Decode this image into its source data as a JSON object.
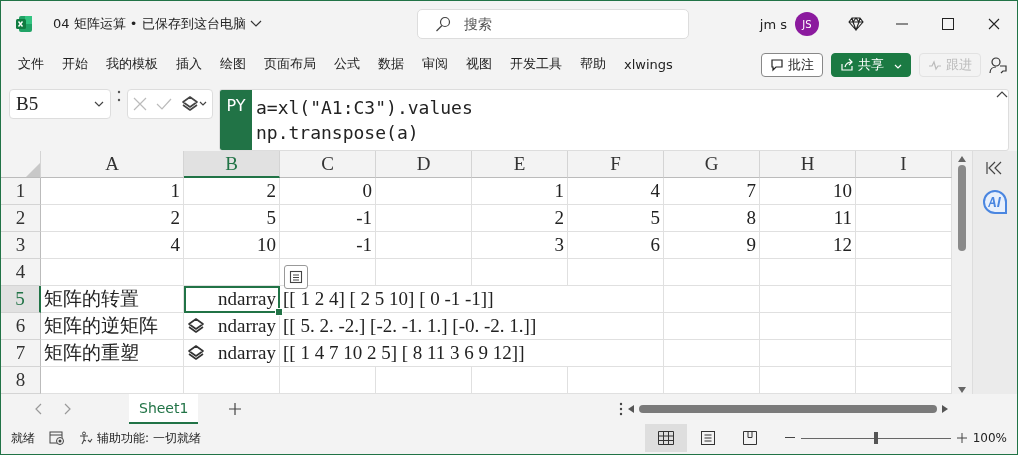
{
  "window": {
    "title": "04 矩阵运算 • 已保存到这台电脑",
    "search": {
      "placeholder": "搜索"
    },
    "user": {
      "name": "jm s",
      "initials": "JS"
    }
  },
  "ribbon_tabs": [
    {
      "label": "文件",
      "selected": false
    },
    {
      "label": "开始",
      "selected": false
    },
    {
      "label": "我的模板",
      "selected": false
    },
    {
      "label": "插入",
      "selected": false
    },
    {
      "label": "绘图",
      "selected": false
    },
    {
      "label": "页面布局",
      "selected": false
    },
    {
      "label": "公式",
      "selected": false
    },
    {
      "label": "数据",
      "selected": false
    },
    {
      "label": "审阅",
      "selected": false
    },
    {
      "label": "视图",
      "selected": false
    },
    {
      "label": "开发工具",
      "selected": false
    },
    {
      "label": "帮助",
      "selected": false
    },
    {
      "label": "xlwings",
      "selected": false
    }
  ],
  "ribbon_buttons": [
    {
      "kind": "comment",
      "label": "批注",
      "disabled": false
    },
    {
      "kind": "share",
      "label": "共享",
      "disabled": false
    },
    {
      "kind": "follow",
      "label": "跟进",
      "disabled": true
    }
  ],
  "formula_bar": {
    "name_box": "B5",
    "badge": "PY",
    "lines": [
      "a=xl(\"A1:C3\").values",
      "np.transpose(a)"
    ]
  },
  "columns": [
    {
      "label": "A",
      "selected": false
    },
    {
      "label": "B",
      "selected": true
    },
    {
      "label": "C",
      "selected": false
    },
    {
      "label": "D",
      "selected": false
    },
    {
      "label": "E",
      "selected": false
    },
    {
      "label": "F",
      "selected": false
    },
    {
      "label": "G",
      "selected": false
    },
    {
      "label": "H",
      "selected": false
    },
    {
      "label": "I",
      "selected": false
    }
  ],
  "rows": [
    {
      "label": "1",
      "selected": false,
      "cells": [
        {
          "kind": "number",
          "text": "1"
        },
        {
          "kind": "number",
          "text": "2"
        },
        {
          "kind": "number",
          "text": "0"
        },
        null,
        {
          "kind": "number",
          "text": "1"
        },
        {
          "kind": "number",
          "text": "4"
        },
        {
          "kind": "number",
          "text": "7"
        },
        {
          "kind": "number",
          "text": "10"
        },
        null
      ]
    },
    {
      "label": "2",
      "selected": false,
      "cells": [
        {
          "kind": "number",
          "text": "2"
        },
        {
          "kind": "number",
          "text": "5"
        },
        {
          "kind": "number",
          "text": "-1"
        },
        null,
        {
          "kind": "number",
          "text": "2"
        },
        {
          "kind": "number",
          "text": "5"
        },
        {
          "kind": "number",
          "text": "8"
        },
        {
          "kind": "number",
          "text": "11"
        },
        null
      ]
    },
    {
      "label": "3",
      "selected": false,
      "cells": [
        {
          "kind": "number",
          "text": "4"
        },
        {
          "kind": "number",
          "text": "10"
        },
        {
          "kind": "number",
          "text": "-1"
        },
        null,
        {
          "kind": "number",
          "text": "3"
        },
        {
          "kind": "number",
          "text": "6"
        },
        {
          "kind": "number",
          "text": "9"
        },
        {
          "kind": "number",
          "text": "12"
        },
        null
      ]
    },
    {
      "label": "4",
      "selected": false,
      "cells": [
        null,
        null,
        null,
        null,
        null,
        null,
        null,
        null,
        null
      ]
    },
    {
      "label": "5",
      "selected": true,
      "cells": [
        {
          "kind": "text",
          "text": "矩阵的转置"
        },
        {
          "kind": "python",
          "text": "ndarray",
          "icon": false
        },
        {
          "kind": "text",
          "text": "[[ 1  2  4] [ 2  5 10] [ 0 -1 -1]]"
        },
        null,
        null,
        null,
        null,
        null,
        null
      ]
    },
    {
      "label": "6",
      "selected": false,
      "cells": [
        {
          "kind": "text",
          "text": "矩阵的逆矩阵"
        },
        {
          "kind": "python",
          "text": "ndarray",
          "icon": true
        },
        {
          "kind": "text",
          "text": "[[ 5.  2. -2.] [-2. -1.  1.] [-0. -2.  1.]]"
        },
        null,
        null,
        null,
        null,
        null,
        null
      ]
    },
    {
      "label": "7",
      "selected": false,
      "cells": [
        {
          "kind": "text",
          "text": "矩阵的重塑"
        },
        {
          "kind": "python",
          "text": "ndarray",
          "icon": true
        },
        {
          "kind": "text",
          "text": "[[ 1  4  7 10  2  5] [ 8 11  3  6  9 12]]"
        },
        null,
        null,
        null,
        null,
        null,
        null
      ]
    },
    {
      "label": "8",
      "selected": false,
      "cells": [
        null,
        null,
        null,
        null,
        null,
        null,
        null,
        null,
        null
      ]
    }
  ],
  "sheet_tabs": [
    {
      "label": "Sheet1",
      "selected": true
    }
  ],
  "status_bar": {
    "status": "就绪",
    "accessibility": "辅助功能: 一切就绪",
    "views": [
      {
        "kind": "normal",
        "selected": true
      },
      {
        "kind": "page_layout",
        "selected": false
      },
      {
        "kind": "page_break",
        "selected": false
      }
    ],
    "zoom": {
      "level": 0.5,
      "reading": "100%"
    }
  }
}
